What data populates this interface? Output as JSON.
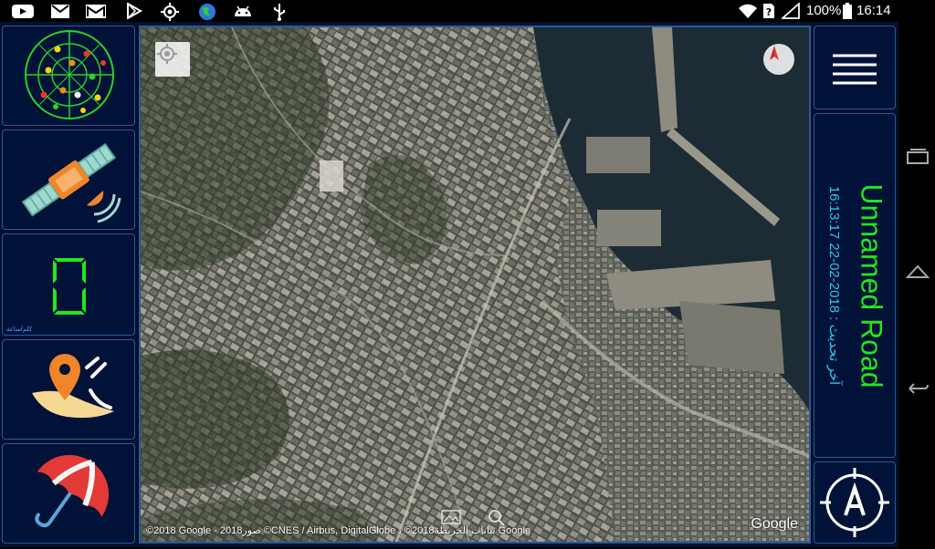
{
  "status_bar": {
    "left_icons": [
      "youtube-icon",
      "gmail-icon",
      "gmail-icon",
      "play-store-icon",
      "gps-icon",
      "globe-app-icon",
      "android-icon",
      "usb-icon"
    ],
    "battery": "100%",
    "time": "16:14"
  },
  "left_sidebar": {
    "items": [
      {
        "name": "satellite-radar",
        "icon": "satellite-skyplot-icon"
      },
      {
        "name": "satellite",
        "icon": "satellite-icon"
      },
      {
        "name": "speed",
        "icon": "speed-display-icon",
        "value": "0",
        "unit": "كلم/ساعة"
      },
      {
        "name": "location",
        "icon": "map-pin-icon"
      },
      {
        "name": "weather",
        "icon": "umbrella-icon"
      }
    ]
  },
  "map": {
    "type": "satellite",
    "attribution": "©2018 Google - 2018صور ©CNES / Airbus, DigitalGlobe ، ©2018بيانات الخريطة Google",
    "logo": "Google"
  },
  "right_panel": {
    "street": "Unnamed Road",
    "last_updated": "آخر تحديث : 2018-02-22 16:13:17"
  },
  "colors": {
    "panel_bg": "#001238",
    "panel_border": "#2a5a9a",
    "street_green": "#1ee81e",
    "update_cyan": "#2ec8ee"
  }
}
